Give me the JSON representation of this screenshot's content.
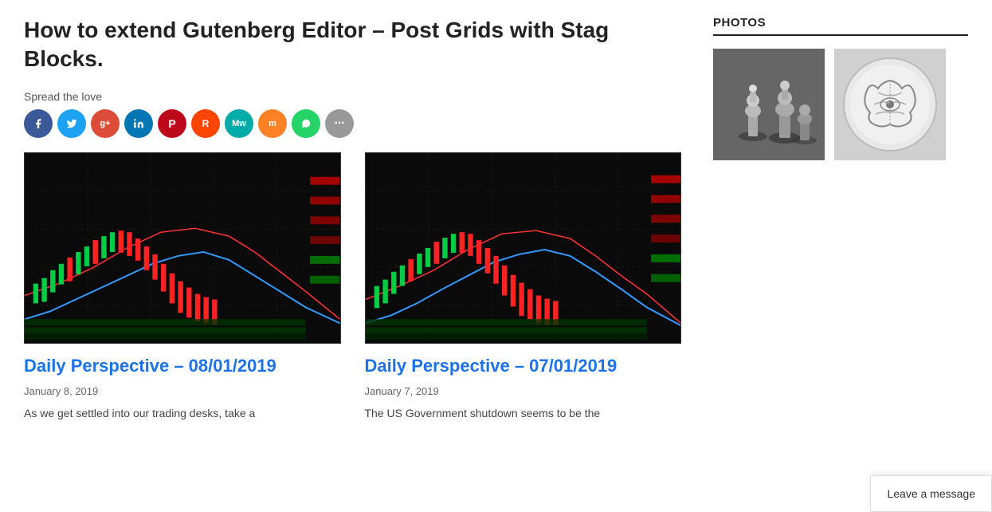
{
  "article": {
    "title": "How to extend Gutenberg Editor – Post Grids with Stag Blocks.",
    "spread_love": "Spread the love"
  },
  "social_icons": [
    {
      "name": "facebook",
      "label": "f",
      "class": "si-fb"
    },
    {
      "name": "twitter",
      "label": "t",
      "class": "si-tw"
    },
    {
      "name": "google-plus",
      "label": "g+",
      "class": "si-gp"
    },
    {
      "name": "linkedin",
      "label": "in",
      "class": "si-li"
    },
    {
      "name": "pinterest",
      "label": "P",
      "class": "si-pi"
    },
    {
      "name": "reddit",
      "label": "r",
      "class": "si-rd"
    },
    {
      "name": "mewe",
      "label": "Mw",
      "class": "si-mw"
    },
    {
      "name": "mix",
      "label": "m",
      "class": "si-mix"
    },
    {
      "name": "whatsapp",
      "label": "W",
      "class": "si-wa"
    },
    {
      "name": "more",
      "label": "···",
      "class": "si-more"
    }
  ],
  "posts": [
    {
      "id": "post-1",
      "title": "Daily Perspective – 08/01/2019",
      "date": "January 8, 2019",
      "excerpt": "As we get settled into our trading desks, take a"
    },
    {
      "id": "post-2",
      "title": "Daily Perspective – 07/01/2019",
      "date": "January 7, 2019",
      "excerpt": "The US Government shutdown seems to be the"
    }
  ],
  "sidebar": {
    "photos_label": "PHOTOS"
  },
  "leave_message": {
    "label": "Leave a message"
  }
}
